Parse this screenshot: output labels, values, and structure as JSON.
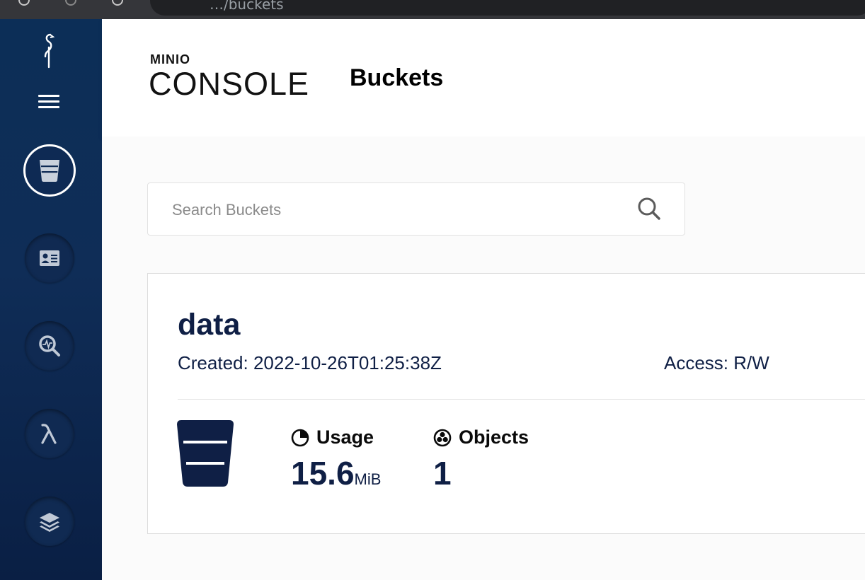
{
  "browser": {
    "address_fragment": "…/buckets"
  },
  "sidebar": {
    "logo": "minio-logo-icon",
    "menu_icon": "hamburger-menu-icon",
    "items": [
      {
        "icon": "bucket-icon",
        "active": true
      },
      {
        "icon": "id-card-icon",
        "active": false
      },
      {
        "icon": "monitoring-search-icon",
        "active": false
      },
      {
        "icon": "lambda-icon",
        "active": false
      },
      {
        "icon": "layers-icon",
        "active": false
      }
    ]
  },
  "header": {
    "brand_top": "MINIO",
    "brand_bottom": "CONSOLE",
    "title": "Buckets"
  },
  "search": {
    "placeholder": "Search Buckets",
    "value": "",
    "icon": "search-icon"
  },
  "bucket": {
    "name": "data",
    "created": "Created: 2022-10-26T01:25:38Z",
    "access": "Access: R/W",
    "usage_label": "Usage",
    "usage_value": "15.6",
    "usage_unit": "MiB",
    "objects_label": "Objects",
    "objects_value": "1"
  },
  "colors": {
    "sidebar": "#0c2e57",
    "text_primary": "#0f1f45",
    "active_outline": "#ffffff"
  }
}
